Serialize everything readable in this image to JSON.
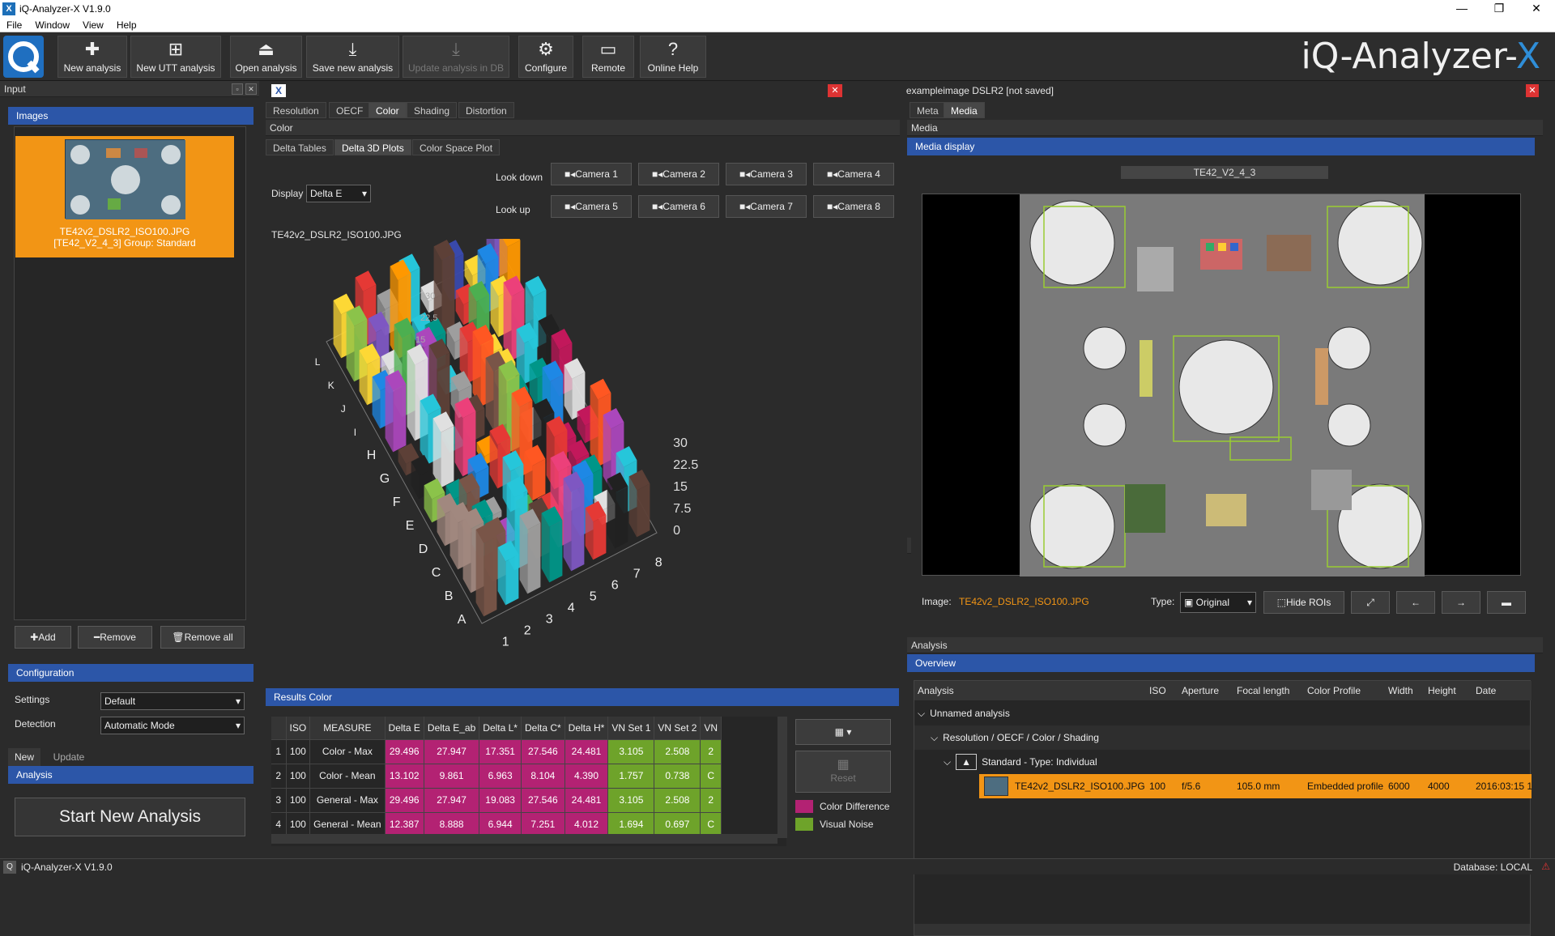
{
  "window": {
    "title": "iQ-Analyzer-X V1.9.0",
    "minimize": "—",
    "restore": "❐",
    "close": "✕"
  },
  "menu": [
    "File",
    "Window",
    "View",
    "Help"
  ],
  "toolbar": {
    "new_analysis": "New analysis",
    "new_utt": "New UTT analysis",
    "open_analysis": "Open analysis",
    "save_new": "Save new analysis",
    "update_db": "Update analysis in DB",
    "configure": "Configure",
    "remote": "Remote",
    "online_help": "Online Help"
  },
  "brand": {
    "text": "iQ-Analyzer-",
    "accent": "X"
  },
  "input": {
    "title": "Input",
    "images_header": "Images",
    "thumb_line1": "TE42v2_DSLR2_ISO100.JPG",
    "thumb_line2": "[TE42_V2_4_3] Group: Standard",
    "add": "Add",
    "remove": "Remove",
    "remove_all": "Remove all",
    "config_header": "Configuration",
    "settings_label": "Settings",
    "settings_value": "Default",
    "detection_label": "Detection",
    "detection_value": "Automatic Mode",
    "tab_new": "New",
    "tab_update": "Update",
    "analysis_header": "Analysis",
    "start_button": "Start New Analysis"
  },
  "doc": {
    "title": "exampleimage DSLR2  [not saved]"
  },
  "center": {
    "tabs": [
      "Resolution",
      "OECF",
      "Color",
      "Shading",
      "Distortion"
    ],
    "panel_title": "Color",
    "subtabs": [
      "Delta Tables",
      "Delta 3D Plots",
      "Color Space Plot"
    ],
    "display_label": "Display",
    "display_value": "Delta E",
    "look_down": "Look down",
    "look_up": "Look up",
    "cameras": [
      "Camera 1",
      "Camera 2",
      "Camera 3",
      "Camera 4",
      "Camera 5",
      "Camera 6",
      "Camera 7",
      "Camera 8"
    ],
    "plot_title": "TE42v2_DSLR2_ISO100.JPG"
  },
  "chart_data": {
    "type": "bar",
    "title": "TE42v2_DSLR2_ISO100.JPG",
    "row_labels": [
      "A",
      "B",
      "C",
      "D",
      "E",
      "F",
      "G",
      "H",
      "I",
      "J",
      "K",
      "L"
    ],
    "col_labels": [
      "1",
      "2",
      "3",
      "4",
      "5",
      "6",
      "7",
      "8"
    ],
    "z_ticks": [
      "0",
      "7.5",
      "15",
      "22.5",
      "30"
    ],
    "zlim": [
      0,
      30
    ]
  },
  "results": {
    "header": "Results Color",
    "columns": [
      "ISO",
      "MEASURE",
      "Delta E",
      "Delta E_ab",
      "Delta L*",
      "Delta C*",
      "Delta H*",
      "VN Set 1",
      "VN Set 2",
      "VN"
    ],
    "rows": [
      [
        "1",
        "100",
        "Color - Max",
        "29.496",
        "27.947",
        "17.351",
        "27.546",
        "24.481",
        "3.105",
        "2.508",
        "2"
      ],
      [
        "2",
        "100",
        "Color - Mean",
        "13.102",
        "9.861",
        "6.963",
        "8.104",
        "4.390",
        "1.757",
        "0.738",
        "C"
      ],
      [
        "3",
        "100",
        "General - Max",
        "29.496",
        "27.947",
        "19.083",
        "27.546",
        "24.481",
        "3.105",
        "2.508",
        "2"
      ],
      [
        "4",
        "100",
        "General - Mean",
        "12.387",
        "8.888",
        "6.944",
        "7.251",
        "4.012",
        "1.694",
        "0.697",
        "C"
      ]
    ],
    "reset": "Reset",
    "legend_color": "Color Difference",
    "legend_noise": "Visual Noise",
    "color_pink": "#b32273",
    "color_green": "#6ea32a"
  },
  "right": {
    "tab_meta": "Meta",
    "tab_media": "Media",
    "media_title": "Media",
    "media_display": "Media display",
    "chart_name": "TE42_V2_4_3",
    "image_label": "Image:",
    "image_value": "TE42v2_DSLR2_ISO100.JPG",
    "type_label": "Type:",
    "type_value": "Original",
    "hide_rois": "Hide ROIs"
  },
  "analysis": {
    "title": "Analysis",
    "overview": "Overview",
    "columns": [
      "Analysis",
      "ISO",
      "Aperture",
      "Focal length",
      "Color Profile",
      "Width",
      "Height",
      "Date"
    ],
    "tree1": "Unnamed analysis",
    "tree2": "Resolution / OECF / Color / Shading",
    "tree3": "Standard - Type: Individual",
    "item": {
      "file": "TE42v2_DSLR2_ISO100.JPG",
      "iso": "100",
      "aperture": "f/5.6",
      "focal": "105.0 mm",
      "profile": "Embedded profile",
      "width": "6000",
      "height": "4000",
      "date": "2016:03:15 1"
    }
  },
  "status": {
    "left": "iQ-Analyzer-X V1.9.0",
    "right": "Database: LOCAL"
  }
}
